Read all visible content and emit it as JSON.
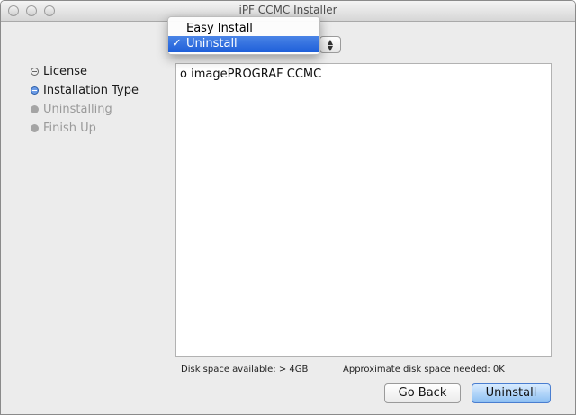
{
  "window": {
    "title": "iPF CCMC Installer"
  },
  "sidebar": {
    "steps": [
      {
        "label": "License",
        "state": "done"
      },
      {
        "label": "Installation Type",
        "state": "current"
      },
      {
        "label": "Uninstalling",
        "state": "pending"
      },
      {
        "label": "Finish Up",
        "state": "pending"
      }
    ]
  },
  "install_type_menu": {
    "options": [
      {
        "label": "Easy Install",
        "checked": false
      },
      {
        "label": "Uninstall",
        "checked": true
      }
    ],
    "check_mark": "✓"
  },
  "component_list": {
    "items": [
      "o imagePROGRAF CCMC"
    ]
  },
  "disk": {
    "available": "Disk space available: > 4GB",
    "needed": "Approximate disk space needed: 0K"
  },
  "buttons": {
    "back": "Go Back",
    "uninstall": "Uninstall"
  },
  "colors": {
    "selection": "#2c6de0",
    "default_button": "#8cbff2"
  }
}
